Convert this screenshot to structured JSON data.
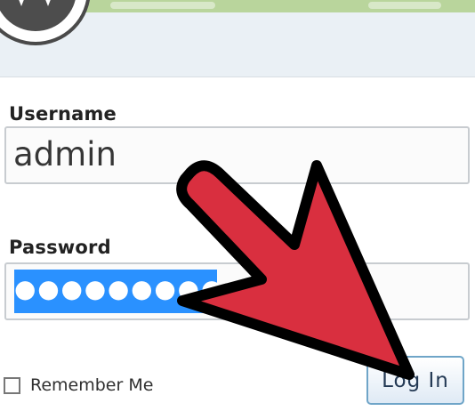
{
  "page": {
    "username_label": "Username",
    "username_value": "admin",
    "password_label": "Password",
    "password_value": "●●●●●●●●●",
    "remember_label": "Remember Me",
    "login_button_label": "Log In"
  },
  "icons": {
    "logo": "wordpress-logo",
    "arrow": "red-pointer-arrow",
    "checkbox": "unchecked-checkbox"
  },
  "colors": {
    "accent": "#2a91ff",
    "arrow": "#d92f3f",
    "button_border": "#6fa5c8"
  }
}
